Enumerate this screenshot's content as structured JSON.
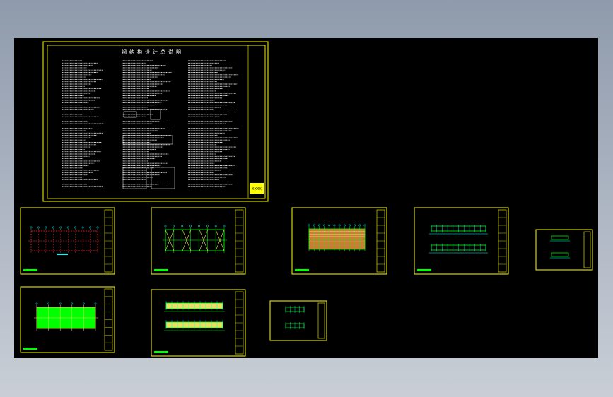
{
  "drawing": {
    "cover_title": "钢结构设计总说明",
    "title_block_stamp": "XXXX"
  },
  "colors": {
    "background": "#000000",
    "frame": "#ffff00",
    "text": "#ffffff",
    "line_green": "#00ff00",
    "line_cyan": "#00ffff",
    "dim_red": "#ff3030",
    "fill_green": "#00ff00",
    "fill_orange": "#d07a3a",
    "fill_yellow": "#e8e060"
  },
  "sheets": [
    {
      "id": "cover-sheet",
      "kind": "cover"
    },
    {
      "id": "foundation-plan",
      "kind": "plan-red"
    },
    {
      "id": "roof-framing-plan",
      "kind": "plan-bracing"
    },
    {
      "id": "purlin-plan",
      "kind": "plan-orange"
    },
    {
      "id": "elevations-a",
      "kind": "elevation-pair"
    },
    {
      "id": "detail-sheet",
      "kind": "small-detail"
    },
    {
      "id": "roof-plan-green",
      "kind": "plan-green"
    },
    {
      "id": "elevations-b",
      "kind": "elevation-pair-yellow"
    },
    {
      "id": "section-details",
      "kind": "small-detail-2"
    }
  ]
}
